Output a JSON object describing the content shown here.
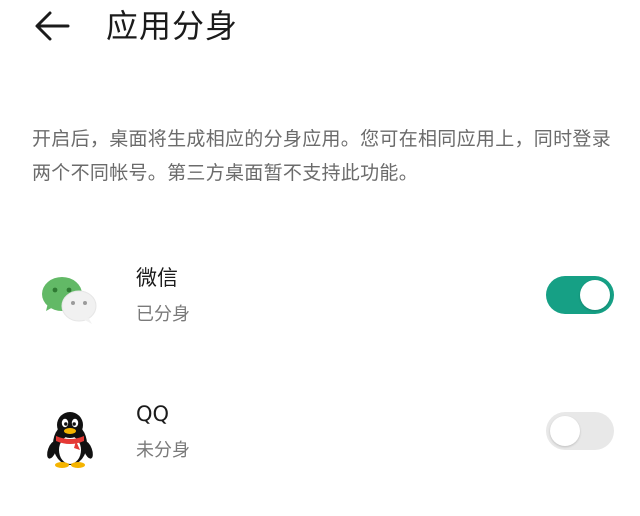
{
  "header": {
    "title": "应用分身",
    "back_icon": "arrow-left-icon"
  },
  "description": "开启后，桌面将生成相应的分身应用。您可在相同应用上，同时登录两个不同帐号。第三方桌面暂不支持此功能。",
  "apps": [
    {
      "name": "微信",
      "status": "已分身",
      "icon": "wechat-icon",
      "enabled": true
    },
    {
      "name": "QQ",
      "status": "未分身",
      "icon": "qq-penguin-icon",
      "enabled": false
    }
  ],
  "colors": {
    "toggle_on": "#16a085",
    "toggle_off": "#e8e8e8",
    "wechat_green": "#5cb85c"
  }
}
